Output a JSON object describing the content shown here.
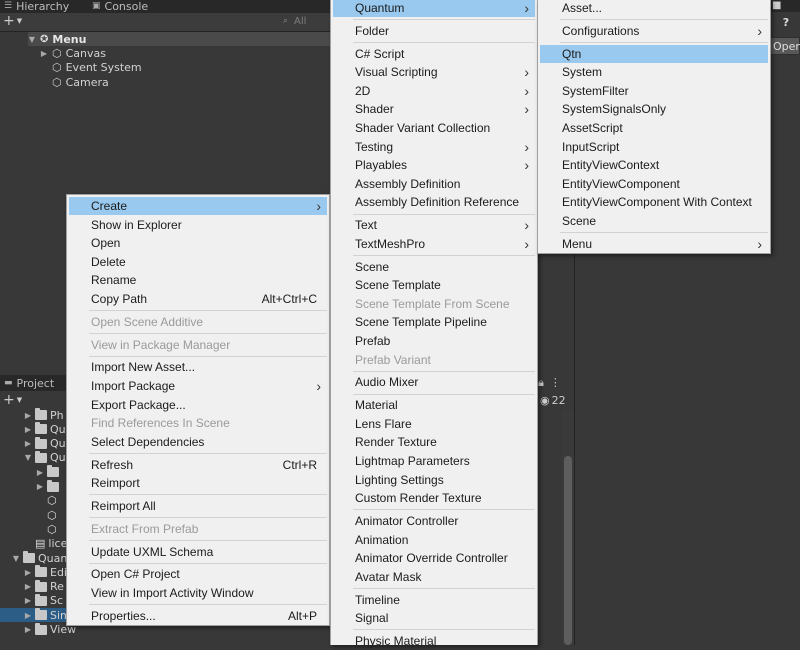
{
  "hierarchy": {
    "tab_label": "Hierarchy",
    "console_tab_label": "Console",
    "add_label": "+",
    "search_placeholder": "All",
    "root": "Menu",
    "children": [
      "Canvas",
      "Event System",
      "Camera"
    ]
  },
  "project": {
    "tab_label": "Project",
    "add_label": "+",
    "hidden_count": "22",
    "rows": [
      {
        "text": "Ph",
        "indent": 2,
        "folder": true
      },
      {
        "text": "Qu",
        "indent": 2,
        "folder": true
      },
      {
        "text": "Qu",
        "indent": 2,
        "folder": true
      },
      {
        "text": "Qu",
        "indent": 2,
        "folder": true,
        "open": true
      },
      {
        "text": "",
        "indent": 3,
        "folder": true
      },
      {
        "text": "",
        "indent": 3,
        "folder": true
      },
      {
        "text": "",
        "indent": 3,
        "asset": "cube"
      },
      {
        "text": "",
        "indent": 3,
        "asset": "cube"
      },
      {
        "text": "",
        "indent": 3,
        "asset": "cube"
      },
      {
        "text": "lice",
        "indent": 2,
        "asset": "doc"
      },
      {
        "text": "Quan",
        "indent": 1,
        "folder": true,
        "open": true
      },
      {
        "text": "Edi",
        "indent": 2,
        "folder": true
      },
      {
        "text": "Re",
        "indent": 2,
        "folder": true
      },
      {
        "text": "Sc",
        "indent": 2,
        "folder": true
      },
      {
        "text": "Simulation",
        "indent": 2,
        "folder": true,
        "selected": true
      },
      {
        "text": "View",
        "indent": 2,
        "folder": true
      }
    ]
  },
  "inspector": {
    "open_button_label": "Open",
    "help_icon_label": "?"
  },
  "context_menu": {
    "items": [
      {
        "label": "Create",
        "submenu": true,
        "highlighted": true
      },
      {
        "label": "Show in Explorer"
      },
      {
        "label": "Open"
      },
      {
        "label": "Delete"
      },
      {
        "label": "Rename"
      },
      {
        "label": "Copy Path",
        "shortcut": "Alt+Ctrl+C"
      },
      {
        "sep": true
      },
      {
        "label": "Open Scene Additive",
        "disabled": true
      },
      {
        "sep": true
      },
      {
        "label": "View in Package Manager",
        "disabled": true
      },
      {
        "sep": true
      },
      {
        "label": "Import New Asset..."
      },
      {
        "label": "Import Package",
        "submenu": true
      },
      {
        "label": "Export Package..."
      },
      {
        "label": "Find References In Scene",
        "disabled": true
      },
      {
        "label": "Select Dependencies"
      },
      {
        "sep": true
      },
      {
        "label": "Refresh",
        "shortcut": "Ctrl+R"
      },
      {
        "label": "Reimport"
      },
      {
        "sep": true
      },
      {
        "label": "Reimport All"
      },
      {
        "sep": true
      },
      {
        "label": "Extract From Prefab",
        "disabled": true
      },
      {
        "sep": true
      },
      {
        "label": "Update UXML Schema"
      },
      {
        "sep": true
      },
      {
        "label": "Open C# Project"
      },
      {
        "label": "View in Import Activity Window"
      },
      {
        "sep": true
      },
      {
        "label": "Properties...",
        "shortcut": "Alt+P"
      }
    ]
  },
  "create_menu": {
    "items": [
      {
        "label": "Quantum",
        "submenu": true,
        "highlighted": true
      },
      {
        "sep": true
      },
      {
        "label": "Folder"
      },
      {
        "sep": true
      },
      {
        "label": "C# Script"
      },
      {
        "label": "Visual Scripting",
        "submenu": true
      },
      {
        "label": "2D",
        "submenu": true
      },
      {
        "label": "Shader",
        "submenu": true
      },
      {
        "label": "Shader Variant Collection"
      },
      {
        "label": "Testing",
        "submenu": true
      },
      {
        "label": "Playables",
        "submenu": true
      },
      {
        "label": "Assembly Definition"
      },
      {
        "label": "Assembly Definition Reference"
      },
      {
        "sep": true
      },
      {
        "label": "Text",
        "submenu": true
      },
      {
        "label": "TextMeshPro",
        "submenu": true
      },
      {
        "sep": true
      },
      {
        "label": "Scene"
      },
      {
        "label": "Scene Template"
      },
      {
        "label": "Scene Template From Scene",
        "disabled": true
      },
      {
        "label": "Scene Template Pipeline"
      },
      {
        "label": "Prefab"
      },
      {
        "label": "Prefab Variant",
        "disabled": true
      },
      {
        "sep": true
      },
      {
        "label": "Audio Mixer"
      },
      {
        "sep": true
      },
      {
        "label": "Material"
      },
      {
        "label": "Lens Flare"
      },
      {
        "label": "Render Texture"
      },
      {
        "label": "Lightmap Parameters"
      },
      {
        "label": "Lighting Settings"
      },
      {
        "label": "Custom Render Texture"
      },
      {
        "sep": true
      },
      {
        "label": "Animator Controller"
      },
      {
        "label": "Animation"
      },
      {
        "label": "Animator Override Controller"
      },
      {
        "label": "Avatar Mask"
      },
      {
        "sep": true
      },
      {
        "label": "Timeline"
      },
      {
        "label": "Signal"
      },
      {
        "sep": true
      },
      {
        "label": "Physic Material"
      }
    ]
  },
  "quantum_menu": {
    "items": [
      {
        "label": "Asset..."
      },
      {
        "sep": true
      },
      {
        "label": "Configurations",
        "submenu": true
      },
      {
        "sep": true
      },
      {
        "label": "Qtn",
        "highlighted": true
      },
      {
        "label": "System"
      },
      {
        "label": "SystemFilter"
      },
      {
        "label": "SystemSignalsOnly"
      },
      {
        "label": "AssetScript"
      },
      {
        "label": "InputScript"
      },
      {
        "label": "EntityViewContext"
      },
      {
        "label": "EntityViewComponent"
      },
      {
        "label": "EntityViewComponent With Context"
      },
      {
        "label": "Scene"
      },
      {
        "sep": true
      },
      {
        "label": "Menu",
        "submenu": true
      }
    ]
  },
  "colors": {
    "highlight": "#99c9ef",
    "menu_bg": "#f0f0f0",
    "selection": "#2c5d87"
  }
}
